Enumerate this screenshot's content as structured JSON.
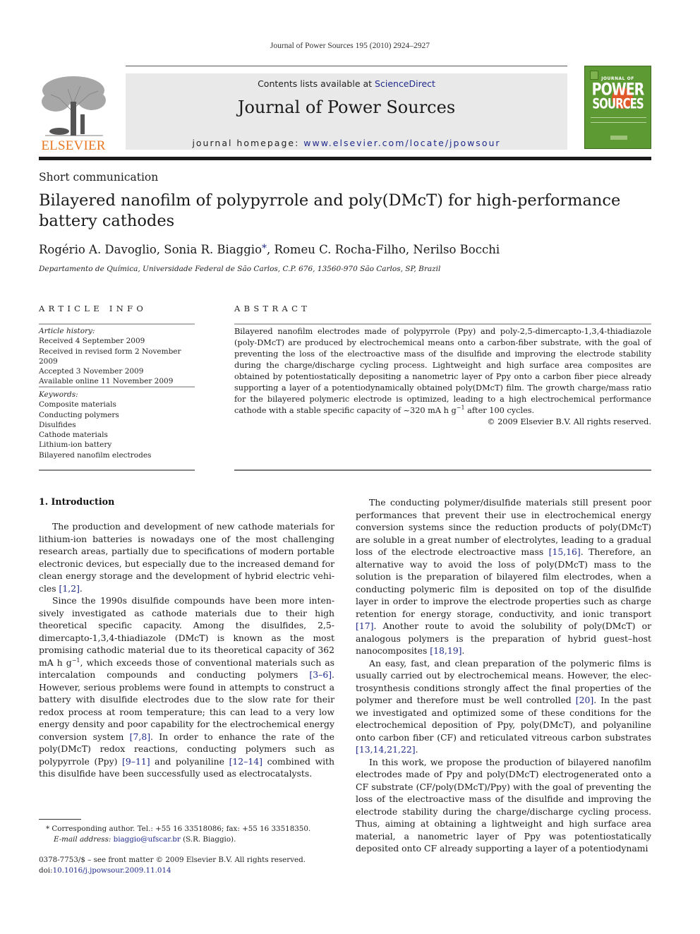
{
  "running_header": "Journal of Power Sources 195 (2010) 2924–2927",
  "masthead": {
    "publisher_logo_text": "ELSEVIER",
    "contents_prefix": "Contents lists available at ",
    "contents_link": "ScienceDirect",
    "journal_title": "Journal of Power Sources",
    "homepage_prefix": "journal homepage: ",
    "homepage_link": "www.elsevier.com/locate/jpowsour",
    "cover": {
      "top_text": "JOURNAL OF",
      "line1": "POWER",
      "line2": "SOURCES",
      "background_color": "#5e9a33",
      "accent_color": "#e0582a"
    },
    "brand_color": "#e87722",
    "link_color": "#1f2a8a"
  },
  "article": {
    "type": "Short communication",
    "title": "Bilayered nanofilm of polypyrrole and poly(DMcT) for high-performance battery cathodes",
    "authors": {
      "a1": "Rogério A. Davoglio, ",
      "a2": "Sonia R. Biaggio",
      "corresponding_mark": "*",
      "a3": ", Romeu C. Rocha-Filho, Nerilso Bocchi"
    },
    "affiliation": "Departamento de Química, Universidade Federal de São Carlos, C.P. 676, 13560-970 São Carlos, SP, Brazil"
  },
  "article_info": {
    "heading": "ARTICLE INFO",
    "history_label": "Article history:",
    "history": [
      "Received 4 September 2009",
      "Received in revised form 2 November 2009",
      "Accepted 3 November 2009",
      "Available online 11 November 2009"
    ],
    "keywords_label": "Keywords:",
    "keywords": [
      "Composite materials",
      "Conducting polymers",
      "Disulfides",
      "Cathode materials",
      "Lithium-ion battery",
      "Bilayered nanofilm electrodes"
    ]
  },
  "abstract": {
    "heading": "ABSTRACT",
    "text_before_sup": "Bilayered nanofilm electrodes made of polypyrrole (Ppy) and poly-2,5-dimercapto-1,3,4-thiadiazole (poly-DMcT) are produced by electrochemical means onto a carbon-fiber substrate, with the goal of preventing the loss of the electroactive mass of the disulfide and improving the electrode stability during the charge/discharge cycling process. Lightweight and high surface area composites are obtained by potentiostatically depositing a nanometric layer of Ppy onto a carbon fiber piece already supporting a layer of a potentiodynamically obtained poly(DMcT) film. The growth charge/mass ratio for the bilayered polymeric electrode is optimized, leading to a high electrochemical performance cathode with a stable specific capacity of ~320 mA h g",
    "sup": "−1",
    "text_after_sup": " after 100 cycles.",
    "copyright": "© 2009 Elsevier B.V. All rights reserved."
  },
  "body": {
    "section_heading": "1.  Introduction",
    "left": [
      {
        "segments": [
          {
            "t": "The production and development of new cathode materials for lithium-ion batteries is nowadays one of the most challenging research areas, partially due to specifications of modern portable electronic devices, but especially due to the increased demand for clean energy storage and the development of hybrid electric vehi­cles "
          },
          {
            "ref": "[1,2]"
          },
          {
            "t": "."
          }
        ]
      },
      {
        "segments": [
          {
            "t": "Since the 1990s disulfide compounds have been more inten­sively investigated as cathode materials due to their high theoretical specific capacity. Among the disulfides, 2,5-dimercapto-1,3,4-thiadiazole (DMcT) is known as the most promising cathodic material due to its theoretical capacity of 362 mA h g"
          },
          {
            "sup": "−1"
          },
          {
            "t": ", which exceeds those of conventional materials such as intercalation compounds and conducting polymers "
          },
          {
            "ref": "[3–6]"
          },
          {
            "t": ". However, serious problems were found in attempts to construct a battery with disul­fide electrodes due to the slow rate for their redox process at room temperature; this can lead to a very low energy density and poor capability for the electrochemical energy conversion system "
          },
          {
            "ref": "[7,8]"
          },
          {
            "t": ". In order to enhance the rate of the poly(DMcT) redox reactions, con­ducting polymers such as polypyrrole (Ppy) "
          },
          {
            "ref": "[9–11]"
          },
          {
            "t": " and polyaniline "
          },
          {
            "ref": "[12–14]"
          },
          {
            "t": " combined with this disulfide have been successfully used as electrocatalysts."
          }
        ]
      }
    ],
    "right": [
      {
        "segments": [
          {
            "t": "The conducting polymer/disulfide materials still present poor performances that prevent their use in electrochemical energy con­version systems since the reduction products of poly(DMcT) are soluble in a great number of electrolytes, leading to a gradual loss of the electrode electroactive mass "
          },
          {
            "ref": "[15,16]"
          },
          {
            "t": ". Therefore, an alter­native way to avoid the loss of poly(DMcT) mass to the solution is the preparation of bilayered film electrodes, when a conduct­ing polymeric film is deposited on top of the disulfide layer in order to improve the electrode properties such as charge retention for energy storage, conductivity, and ionic transport "
          },
          {
            "ref": "[17]"
          },
          {
            "t": ". Another route to avoid the solubility of poly(DMcT) or analogous polymers is the preparation of hybrid guest–host nanocomposites "
          },
          {
            "ref": "[18,19]"
          },
          {
            "t": "."
          }
        ]
      },
      {
        "segments": [
          {
            "t": "An easy, fast, and clean preparation of the polymeric films is usually carried out by electrochemical means. However, the elec­trosynthesis conditions strongly affect the final properties of the polymer and therefore must be well controlled "
          },
          {
            "ref": "[20]"
          },
          {
            "t": ". In the past we investigated and optimized some of these conditions for the electrochemical deposition of Ppy, poly(DMcT), and polyaniline onto carbon fiber (CF) and reticulated vitreous carbon substrates "
          },
          {
            "ref": "[13,14,21,22]"
          },
          {
            "t": "."
          }
        ]
      },
      {
        "segments": [
          {
            "t": "In this work, we propose the production of bilayered nanofilm electrodes made of Ppy and poly(DMcT) electrogenerated onto a CF substrate (CF/poly(DMcT)/Ppy) with the goal of preventing the loss of the electroactive mass of the disulfide and improving the electrode stability during the charge/discharge cycling pro­cess. Thus, aiming at obtaining a lightweight and high surface area material, a nanometric layer of Ppy was potentiostatically deposited onto CF already supporting a layer of a potentiodynami­"
          }
        ]
      }
    ]
  },
  "footnote": {
    "mark": "*",
    "corresponding": " Corresponding author. Tel.: +55 16 33518086; fax: +55 16 33518350.",
    "email_label": "E-mail address:",
    "email": "biaggio@ufscar.br",
    "email_suffix": " (S.R. Biaggio)."
  },
  "front_matter": {
    "issn_line": "0378-7753/$ – see front matter © 2009 Elsevier B.V. All rights reserved.",
    "doi_prefix": "doi:",
    "doi": "10.1016/j.jpowsour.2009.11.014"
  }
}
